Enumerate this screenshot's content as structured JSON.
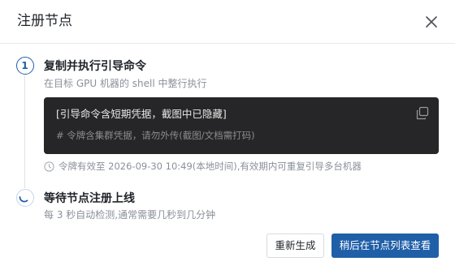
{
  "dialog": {
    "title": "注册节点",
    "close_icon": "close-icon"
  },
  "colors": {
    "primary": "#1f5fa8",
    "code_bg": "#262628",
    "muted_text": "#8a9099"
  },
  "steps": [
    {
      "number": "1",
      "title": "复制并执行引导命令",
      "description": "在目标 GPU 机器的 shell 中整行执行"
    },
    {
      "icon": "spinner-icon",
      "title": "等待节点注册上线",
      "description": "每 3 秒自动检测,通常需要几秒到几分钟"
    }
  ],
  "command": {
    "line": "[引导命令含短期凭据，截图中已隐藏]",
    "comment": "#  令牌含集群凭据，请勿外传(截图/文档需打码)",
    "copy_icon": "copy-icon"
  },
  "expiry": {
    "icon": "clock-icon",
    "text": "令牌有效至 2026-09-30 10:49(本地时间),有效期内可重复引导多台机器"
  },
  "footer": {
    "regenerate_label": "重新生成",
    "view_later_label": "稍后在节点列表查看"
  }
}
